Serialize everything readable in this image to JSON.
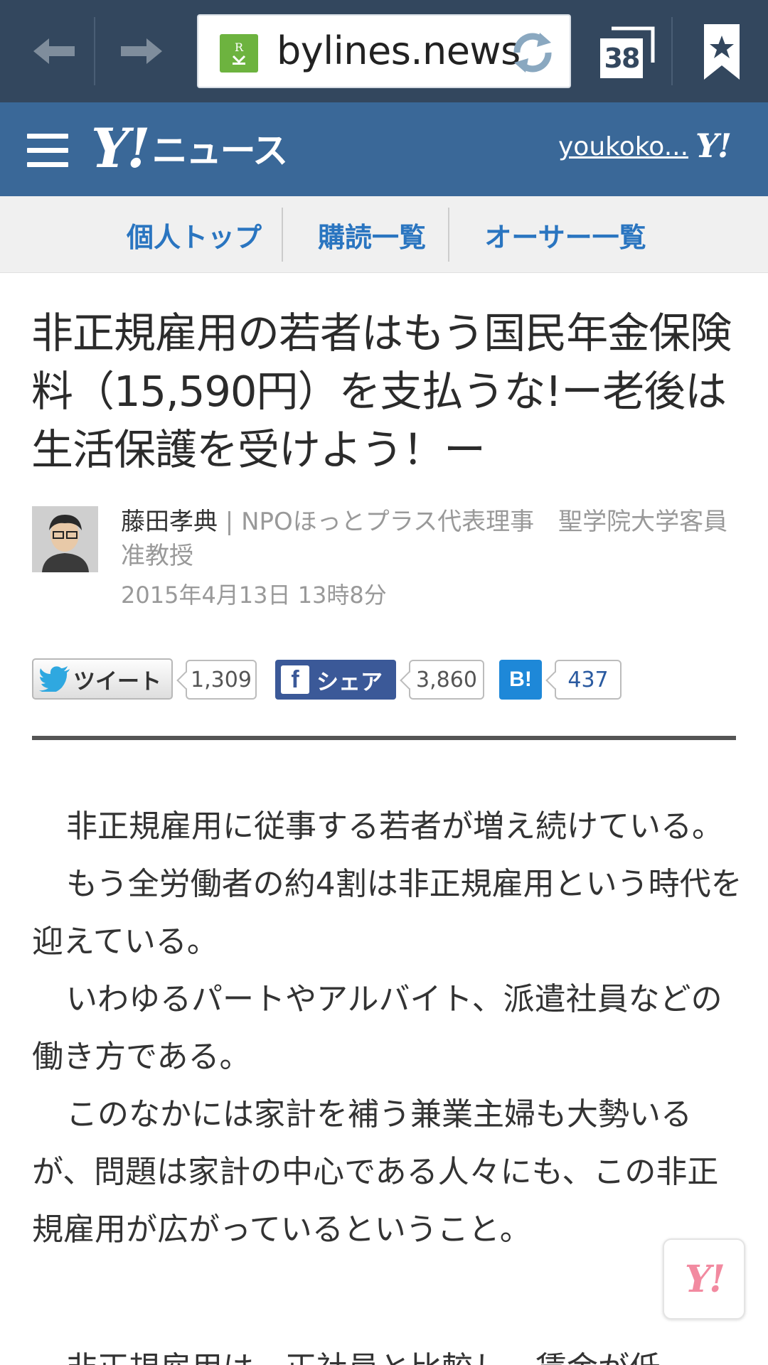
{
  "browser": {
    "url": "bylines.news",
    "tab_count": "38"
  },
  "header": {
    "logo_y": "Y!",
    "logo_text": "ニュース",
    "username": "youkoko...",
    "mini_logo": "Y!"
  },
  "sub_nav": {
    "items": [
      "個人トップ",
      "購読一覧",
      "オーサー一覧"
    ]
  },
  "article": {
    "title": "非正規雇用の若者はもう国民年金保険料（15,590円）を支払うな!ー老後は生活保護を受けよう！ー",
    "author_name": "藤田孝典",
    "author_sep": " | ",
    "author_title": "NPOほっとプラス代表理事　聖学院大学客員准教授",
    "date": "2015年4月13日 13時8分"
  },
  "social": {
    "tweet_label": "ツイート",
    "tweet_count": "1,309",
    "share_label": "シェア",
    "share_count": "3,860",
    "hatena_label": "B!",
    "hatena_count": "437"
  },
  "body": {
    "paragraphs": [
      "非正規雇用に従事する若者が増え続けている。",
      "もう全労働者の約4割は非正規雇用という時代を迎えている。",
      "いわゆるパートやアルバイト、派遣社員などの働き方である。",
      "このなかには家計を補う兼業主婦も大勢いるが、問題は家計の中心である人々にも、この非正規雇用が広がっているということ。"
    ],
    "clipped_line": "非正規雇用は、正社員と比較し、賃金が低"
  },
  "float_button": {
    "label": "Y!"
  },
  "colors": {
    "browser_bar": "#33475e",
    "yahoo_header": "#3a6898",
    "nav_link": "#2a75c0",
    "facebook": "#3b5998",
    "hatena": "#1e88d8"
  }
}
